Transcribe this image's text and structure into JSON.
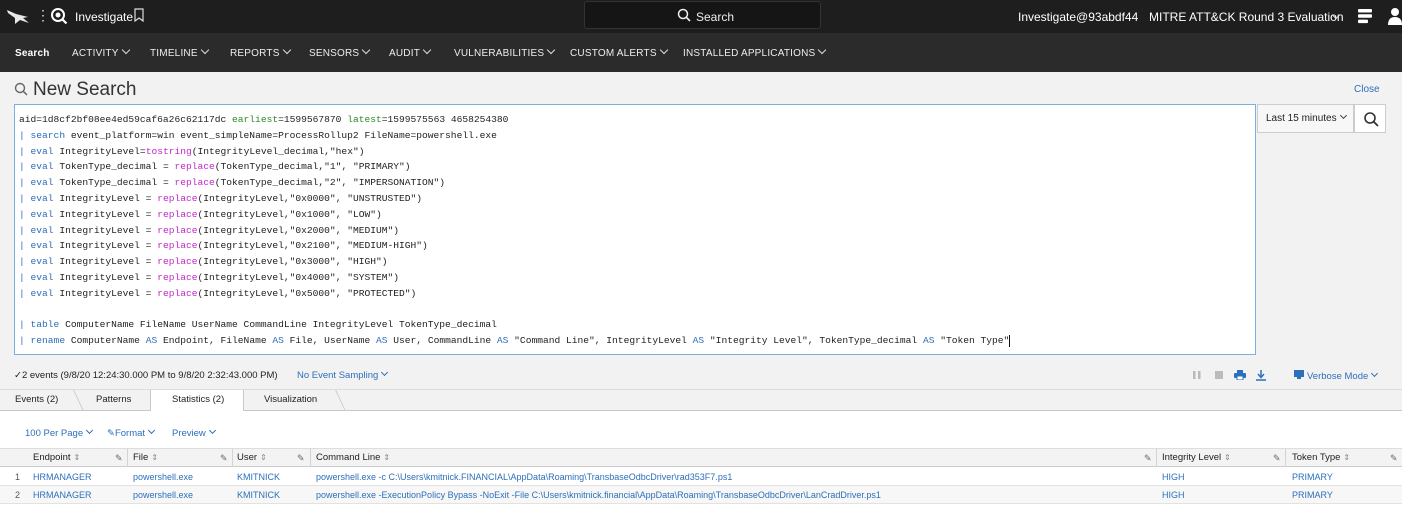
{
  "topbar": {
    "app_name": "Investigate",
    "search_label": "Search",
    "user": "Investigate@93abdf44",
    "tenant": "MITRE ATT&CK Round 3 Evaluation"
  },
  "nav": [
    {
      "label": "Search",
      "active": true
    },
    {
      "label": "ACTIVITY"
    },
    {
      "label": "TIMELINE"
    },
    {
      "label": "REPORTS"
    },
    {
      "label": "SENSORS"
    },
    {
      "label": "AUDIT"
    },
    {
      "label": "VULNERABILITIES"
    },
    {
      "label": "CUSTOM ALERTS"
    },
    {
      "label": "INSTALLED APPLICATIONS"
    }
  ],
  "page": {
    "title": "New Search",
    "close_label": "Close"
  },
  "query": {
    "line1_aid": "aid=1d8cf2bf08ee4ed59caf6a26c62117dc",
    "line1_earliest_kw": "earliest",
    "line1_earliest_val": "=1599567870",
    "line1_latest_kw": "latest",
    "line1_latest_val": "=1599575563 4658254380",
    "line2_kw": "search",
    "line2_rest": " event_platform=win event_simpleName=ProcessRollup2 FileName=powershell.exe",
    "eval_lines": [
      {
        "pre": " IntegrityLevel=",
        "fn": "tostring",
        "post": "(IntegrityLevel_decimal,\"hex\")"
      },
      {
        "pre": " TokenType_decimal = ",
        "fn": "replace",
        "post": "(TokenType_decimal,\"1\", \"PRIMARY\")"
      },
      {
        "pre": " TokenType_decimal = ",
        "fn": "replace",
        "post": "(TokenType_decimal,\"2\", \"IMPERSONATION\")"
      },
      {
        "pre": " IntegrityLevel = ",
        "fn": "replace",
        "post": "(IntegrityLevel,\"0x0000\", \"UNSTRUSTED\")"
      },
      {
        "pre": " IntegrityLevel = ",
        "fn": "replace",
        "post": "(IntegrityLevel,\"0x1000\", \"LOW\")"
      },
      {
        "pre": " IntegrityLevel = ",
        "fn": "replace",
        "post": "(IntegrityLevel,\"0x2000\", \"MEDIUM\")"
      },
      {
        "pre": " IntegrityLevel = ",
        "fn": "replace",
        "post": "(IntegrityLevel,\"0x2100\", \"MEDIUM-HIGH\")"
      },
      {
        "pre": " IntegrityLevel = ",
        "fn": "replace",
        "post": "(IntegrityLevel,\"0x3000\", \"HIGH\")"
      },
      {
        "pre": " IntegrityLevel = ",
        "fn": "replace",
        "post": "(IntegrityLevel,\"0x4000\", \"SYSTEM\")"
      },
      {
        "pre": " IntegrityLevel = ",
        "fn": "replace",
        "post": "(IntegrityLevel,\"0x5000\", \"PROTECTED\")"
      }
    ],
    "eval_kw": "eval",
    "table_kw": "table",
    "table_rest": " ComputerName FileName UserName CommandLine IntegrityLevel TokenType_decimal",
    "rename_kw": "rename",
    "rename_parts": [
      {
        "t": " ComputerName ",
        "k": false
      },
      {
        "t": "AS",
        "k": true
      },
      {
        "t": " Endpoint, FileName ",
        "k": false
      },
      {
        "t": "AS",
        "k": true
      },
      {
        "t": " File, UserName ",
        "k": false
      },
      {
        "t": "AS",
        "k": true
      },
      {
        "t": " User, CommandLine ",
        "k": false
      },
      {
        "t": "AS",
        "k": true
      },
      {
        "t": " \"Command Line\", IntegrityLevel ",
        "k": false
      },
      {
        "t": "AS",
        "k": true
      },
      {
        "t": " \"Integrity Level\", TokenType_decimal ",
        "k": false
      },
      {
        "t": "AS",
        "k": true
      },
      {
        "t": " \"Token Type\"",
        "k": false
      }
    ]
  },
  "time_range": "Last 15 minutes",
  "status": {
    "summary": "2 events (9/8/20 12:24:30.000 PM to 9/8/20 2:32:43.000 PM)",
    "sampling": "No Event Sampling",
    "verbose": "Verbose Mode"
  },
  "tabs": [
    {
      "label": "Events (2)"
    },
    {
      "label": "Patterns"
    },
    {
      "label": "Statistics (2)",
      "active": true
    },
    {
      "label": "Visualization"
    }
  ],
  "results_toolbar": {
    "per_page": "100 Per Page",
    "format": "Format",
    "preview": "Preview"
  },
  "table": {
    "columns": [
      "Endpoint",
      "File",
      "User",
      "Command Line",
      "Integrity Level",
      "Token Type"
    ],
    "rows": [
      {
        "num": "1",
        "cells": [
          "HRMANAGER",
          "powershell.exe",
          "KMITNICK",
          "powershell.exe -c C:\\Users\\kmitnick.FINANCIAL\\AppData\\Roaming\\TransbaseOdbcDriver\\rad353F7.ps1",
          "HIGH",
          "PRIMARY"
        ]
      },
      {
        "num": "2",
        "cells": [
          "HRMANAGER",
          "powershell.exe",
          "KMITNICK",
          "powershell.exe -ExecutionPolicy Bypass -NoExit -File C:\\Users\\kmitnick.financial\\AppData\\Roaming\\TransbaseOdbcDriver\\LanCradDriver.ps1",
          "HIGH",
          "PRIMARY"
        ]
      }
    ]
  },
  "colors": {
    "link": "#2c6fbb",
    "topbar": "#1e1e1e",
    "navbar": "#2b2b2b",
    "keyword": "#2d6db8",
    "function": "#c228c8",
    "time_token": "#2c8a2c"
  }
}
